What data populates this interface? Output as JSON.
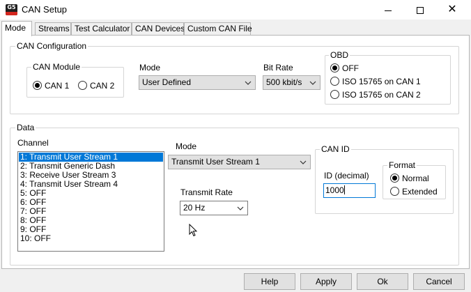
{
  "window": {
    "title": "CAN Setup",
    "icon_text": "G5",
    "minimize_icon": "minimize-icon",
    "maximize_icon": "maximize-icon",
    "close_icon": "close-icon",
    "close_glyph": "✕"
  },
  "tabs": [
    {
      "label": "Mode",
      "active": true
    },
    {
      "label": "Streams",
      "active": false
    },
    {
      "label": "Test Calculator",
      "active": false
    },
    {
      "label": "CAN Devices",
      "active": false
    },
    {
      "label": "Custom CAN File",
      "active": false
    }
  ],
  "can_config": {
    "legend": "CAN Configuration",
    "module": {
      "legend": "CAN Module",
      "options": [
        {
          "label": "CAN 1",
          "checked": true
        },
        {
          "label": "CAN 2",
          "checked": false
        }
      ]
    },
    "mode": {
      "label": "Mode",
      "value": "User Defined"
    },
    "bit_rate": {
      "label": "Bit Rate",
      "value": "500 kbit/s"
    },
    "obd": {
      "legend": "OBD",
      "options": [
        {
          "label": "OFF",
          "checked": true
        },
        {
          "label": "ISO 15765 on CAN 1",
          "checked": false
        },
        {
          "label": "ISO 15765 on CAN 2",
          "checked": false
        }
      ]
    }
  },
  "data_section": {
    "legend": "Data",
    "channel": {
      "label": "Channel",
      "items": [
        "1: Transmit User Stream 1",
        "2: Transmit Generic Dash",
        "3: Receive User Stream 3",
        "4: Transmit User Stream 4",
        "5: OFF",
        "6: OFF",
        "7: OFF",
        "8: OFF",
        "9: OFF",
        "10: OFF"
      ],
      "selected_index": 0
    },
    "mode": {
      "label": "Mode",
      "value": "Transmit User Stream 1"
    },
    "transmit_rate": {
      "label": "Transmit Rate",
      "value": "20 Hz"
    },
    "can_id": {
      "legend": "CAN ID",
      "id_label": "ID (decimal)",
      "id_value": "1000",
      "format": {
        "legend": "Format",
        "options": [
          {
            "label": "Normal",
            "checked": true
          },
          {
            "label": "Extended",
            "checked": false
          }
        ]
      }
    }
  },
  "buttons": {
    "help": "Help",
    "apply": "Apply",
    "ok": "Ok",
    "cancel": "Cancel"
  },
  "colors": {
    "selection": "#0078d7",
    "panel_bg": "#ffffff",
    "window_bg": "#f0f0f0",
    "brand_red": "#d4271f"
  }
}
